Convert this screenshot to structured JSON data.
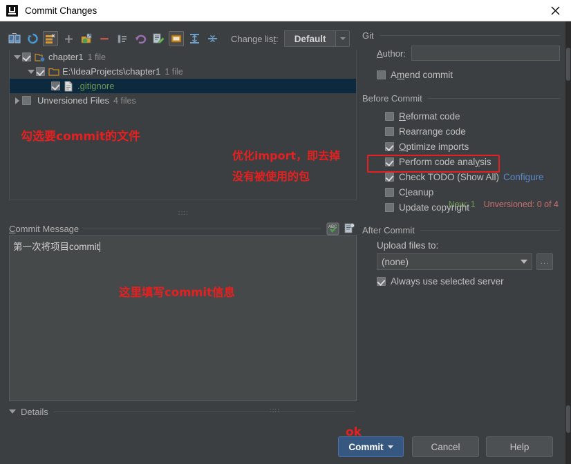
{
  "window": {
    "title": "Commit Changes",
    "app_icon": "intellij-idea-icon",
    "close_label": "×"
  },
  "toolbar": {
    "buttons": [
      {
        "name": "show-diff-icon",
        "label": "Show Diff"
      },
      {
        "name": "refresh-icon",
        "label": "Refresh Changes"
      },
      {
        "name": "group-by-icon",
        "label": "Group By"
      },
      {
        "name": "add-icon",
        "label": "Add"
      },
      {
        "name": "move-to-changelist-icon",
        "label": "Move to Another Changelist"
      },
      {
        "name": "delete-icon",
        "label": "Delete"
      },
      {
        "name": "expand-collapse-icon",
        "label": "Collapse"
      },
      {
        "name": "rollback-icon",
        "label": "Rollback"
      },
      {
        "name": "edit-source-icon",
        "label": "Edit Source"
      },
      {
        "name": "show-ignored-icon",
        "label": "Show Ignored Files"
      },
      {
        "name": "expand-all-icon",
        "label": "Expand All"
      },
      {
        "name": "collapse-all-icon",
        "label": "Collapse All"
      }
    ],
    "changelist_label": "Change list:",
    "changelist_value": "Default"
  },
  "tree": {
    "rows": [
      {
        "indent": 0,
        "twisty": "down",
        "checkbox": "checked",
        "icon": "changelist-folder-icon",
        "label": "chapter1",
        "sub": "1 file",
        "selected": false,
        "label_color": "normal"
      },
      {
        "indent": 1,
        "twisty": "down",
        "checkbox": "checked",
        "icon": "folder-icon",
        "label": "E:\\IdeaProjects\\chapter1",
        "sub": "1 file",
        "selected": false,
        "label_color": "normal"
      },
      {
        "indent": 2,
        "twisty": "none",
        "checkbox": "checked",
        "icon": "file-icon",
        "label": ".gitignore",
        "sub": "",
        "selected": true,
        "label_color": "green"
      },
      {
        "indent": 0,
        "twisty": "right",
        "checkbox": "unchecked",
        "icon": "none",
        "label": "Unversioned Files",
        "sub": "4 files",
        "selected": false,
        "label_color": "normal"
      }
    ]
  },
  "counts": {
    "new": "New: 1",
    "unversioned": "Unversioned: 0 of 4",
    "grip": "∷∷"
  },
  "commit_message": {
    "header": "Commit Message",
    "header_mnemonic": "C",
    "value": "第一次将项目commit",
    "icons": [
      {
        "name": "spellcheck-icon",
        "label": "Spell Checker"
      },
      {
        "name": "history-icon",
        "label": "Show Commit Message History"
      }
    ]
  },
  "details": {
    "label": "Details",
    "expanded": true,
    "grip": "∷∷"
  },
  "git_group": {
    "title": "Git",
    "author_label": "Author:",
    "author_mnemonic": "A",
    "author_value": "",
    "author_placeholder": "",
    "amend_label": "Amend commit",
    "amend_checked": false
  },
  "before_commit": {
    "title": "Before Commit",
    "options": [
      {
        "label": "Reformat code",
        "checked": false,
        "mnemonic": "R",
        "link": ""
      },
      {
        "label": "Rearrange code",
        "checked": false,
        "mnemonic": "",
        "link": ""
      },
      {
        "label": "Optimize imports",
        "checked": true,
        "mnemonic": "O",
        "link": "",
        "highlighted": true
      },
      {
        "label": "Perform code analysis",
        "checked": true,
        "mnemonic": "y",
        "link": ""
      },
      {
        "label": "Check TODO (Show All)",
        "checked": true,
        "mnemonic": "",
        "link": "Configure"
      },
      {
        "label": "Cleanup",
        "checked": false,
        "mnemonic": "l",
        "link": ""
      },
      {
        "label": "Update copyright",
        "checked": false,
        "mnemonic": "",
        "link": ""
      }
    ]
  },
  "after_commit": {
    "title": "After Commit",
    "upload_label": "Upload files to:",
    "upload_value": "(none)",
    "browse_label": "...",
    "always_label": "Always use selected server",
    "always_checked": true
  },
  "buttons": {
    "commit": "Commit",
    "cancel": "Cancel",
    "help": "Help"
  },
  "annotations": {
    "select_files": "勾选要commit的文件",
    "optimize_1": "优化import，即去掉",
    "optimize_2": "没有被使用的包",
    "message_here": "这里填写commit信息",
    "ok": "ok"
  },
  "colors": {
    "accent_blue": "#365880",
    "selection": "#0d293e",
    "annotation_red": "#e62020",
    "link_blue": "#5a87c9",
    "added_green": "#6a9a52",
    "unversioned_red": "#c87070",
    "panel_bg": "#3c3f41"
  }
}
